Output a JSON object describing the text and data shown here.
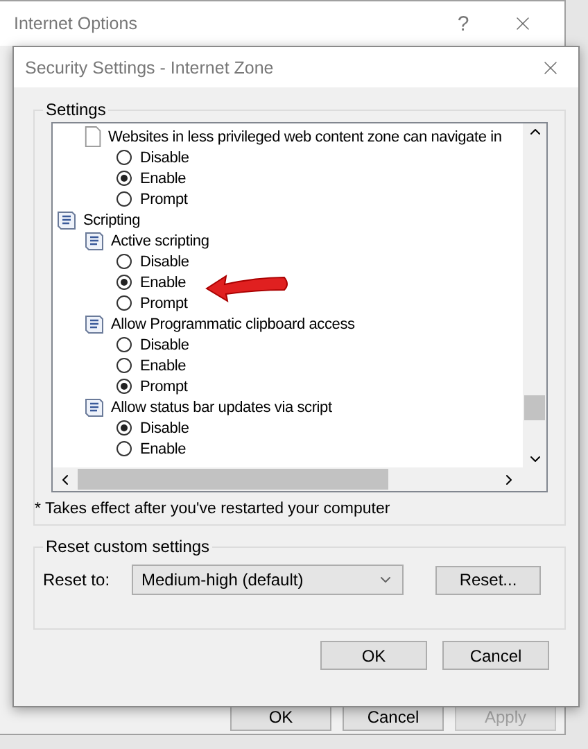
{
  "background_window": {
    "title": "Internet Options",
    "help": "?",
    "buttons": [
      {
        "label": "OK",
        "disabled": false
      },
      {
        "label": "Cancel",
        "disabled": false
      },
      {
        "label": "Apply",
        "disabled": true
      }
    ]
  },
  "dialog": {
    "title": "Security Settings - Internet Zone",
    "settings": {
      "legend": "Settings",
      "tree": [
        {
          "kind": "group",
          "children": [
            {
              "kind": "setting",
              "label": "Websites in less privileged web content zone can navigate in",
              "children": [
                {
                  "kind": "radio",
                  "label": "Disable",
                  "selected": false
                },
                {
                  "kind": "radio",
                  "label": "Enable",
                  "selected": true
                },
                {
                  "kind": "radio",
                  "label": "Prompt",
                  "selected": false
                }
              ]
            }
          ]
        },
        {
          "kind": "script_setting",
          "label": "Scripting",
          "children": [
            {
              "kind": "script_setting",
              "label": "Active scripting",
              "children": [
                {
                  "kind": "radio",
                  "label": "Disable",
                  "selected": false
                },
                {
                  "kind": "radio",
                  "label": "Enable",
                  "selected": true,
                  "annotated": true
                },
                {
                  "kind": "radio",
                  "label": "Prompt",
                  "selected": false
                }
              ]
            },
            {
              "kind": "script_setting",
              "label": "Allow Programmatic clipboard access",
              "children": [
                {
                  "kind": "radio",
                  "label": "Disable",
                  "selected": false
                },
                {
                  "kind": "radio",
                  "label": "Enable",
                  "selected": false
                },
                {
                  "kind": "radio",
                  "label": "Prompt",
                  "selected": true
                }
              ]
            },
            {
              "kind": "script_setting",
              "label": "Allow status bar updates via script",
              "children": [
                {
                  "kind": "radio",
                  "label": "Disable",
                  "selected": true
                },
                {
                  "kind": "radio",
                  "label": "Enable",
                  "selected": false
                }
              ]
            }
          ]
        }
      ],
      "note": "* Takes effect after you've restarted your computer"
    },
    "reset": {
      "legend": "Reset custom settings",
      "label": "Reset to:",
      "value": "Medium-high (default)",
      "button": "Reset..."
    },
    "buttons": [
      "OK",
      "Cancel"
    ]
  }
}
